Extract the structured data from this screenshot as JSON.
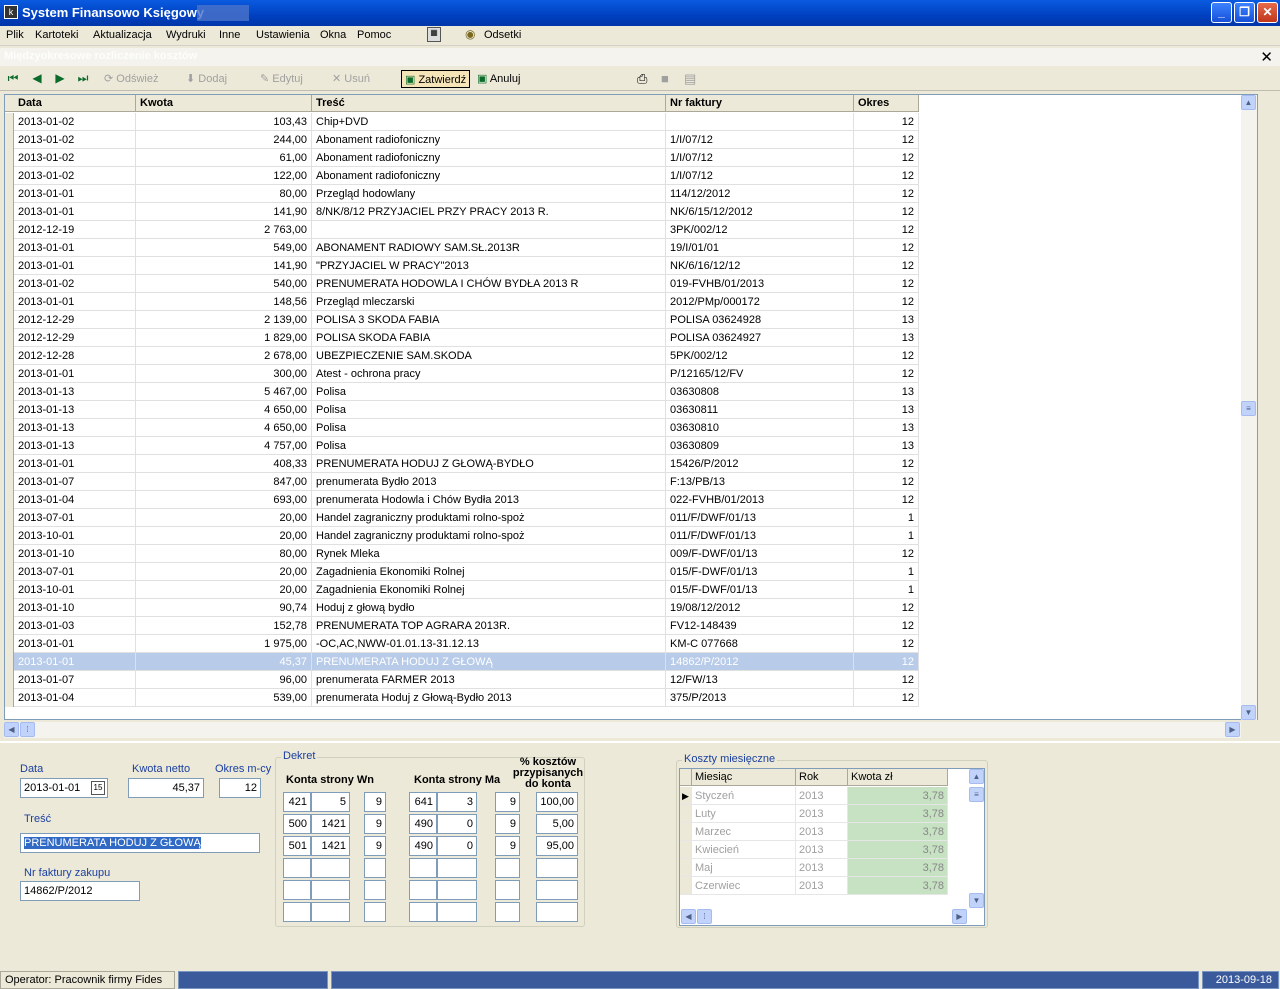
{
  "window": {
    "title": "System Finansowo Księgowy",
    "minimize": "_",
    "maximize": "❐",
    "close": "✕"
  },
  "menu": [
    "Plik",
    "Kartoteki",
    "Aktualizacja",
    "Wydruki",
    "Inne",
    "Ustawienia",
    "Okna",
    "Pomoc"
  ],
  "menu_extra": {
    "odsetki": "Odsetki"
  },
  "subwindow": {
    "title": "Międzyokresowe rozliczenie kosztów",
    "close": "✕"
  },
  "toolbar": {
    "refresh": "Odśwież",
    "add": "Dodaj",
    "edit": "Edytuj",
    "delete": "Usuń",
    "confirm": "Zatwierdź",
    "cancel": "Anuluj"
  },
  "grid": {
    "columns": [
      "Data",
      "Kwota",
      "Treść",
      "Nr faktury",
      "Okres"
    ],
    "rows": [
      [
        "2013-01-02",
        "103,43",
        "Chip+DVD",
        "",
        "12"
      ],
      [
        "2013-01-02",
        "244,00",
        "Abonament radiofoniczny",
        "1/I/07/12",
        "12"
      ],
      [
        "2013-01-02",
        "61,00",
        "Abonament radiofoniczny",
        "1/I/07/12",
        "12"
      ],
      [
        "2013-01-02",
        "122,00",
        "Abonament radiofoniczny",
        "1/I/07/12",
        "12"
      ],
      [
        "2013-01-01",
        "80,00",
        "Przegląd hodowlany",
        "114/12/2012",
        "12"
      ],
      [
        "2013-01-01",
        "141,90",
        "8/NK/8/12 PRZYJACIEL PRZY PRACY 2013 R.",
        "NK/6/15/12/2012",
        "12"
      ],
      [
        "2012-12-19",
        "2 763,00",
        "",
        "3PK/002/12",
        "12"
      ],
      [
        "2013-01-01",
        "549,00",
        "ABONAMENT RADIOWY SAM.SŁ.2013R",
        "19/I/01/01",
        "12"
      ],
      [
        "2013-01-01",
        "141,90",
        "\"PRZYJACIEL W PRACY\"2013",
        "NK/6/16/12/12",
        "12"
      ],
      [
        "2013-01-02",
        "540,00",
        "PRENUMERATA HODOWLA I CHÓW BYDŁA 2013 R",
        "019-FVHB/01/2013",
        "12"
      ],
      [
        "2013-01-01",
        "148,56",
        "Przegląd mleczarski",
        "2012/PMp/000172",
        "12"
      ],
      [
        "2012-12-29",
        "2 139,00",
        "POLISA         3 SKODA FABIA",
        "POLISA 03624928",
        "13"
      ],
      [
        "2012-12-29",
        "1 829,00",
        "POLISA          SKODA FABIA",
        "POLISA 03624927",
        "13"
      ],
      [
        "2012-12-28",
        "2 678,00",
        "UBEZPIECZENIE SAM.SKODA",
        "5PK/002/12",
        "12"
      ],
      [
        "2013-01-01",
        "300,00",
        "Atest - ochrona pracy",
        "P/12165/12/FV",
        "12"
      ],
      [
        "2013-01-13",
        "5 467,00",
        "Polisa",
        "03630808",
        "13"
      ],
      [
        "2013-01-13",
        "4 650,00",
        "Polisa",
        "03630811",
        "13"
      ],
      [
        "2013-01-13",
        "4 650,00",
        "Polisa",
        "03630810",
        "13"
      ],
      [
        "2013-01-13",
        "4 757,00",
        "Polisa",
        "03630809",
        "13"
      ],
      [
        "2013-01-01",
        "408,33",
        "PRENUMERATA HODUJ Z GŁOWĄ-BYDŁO",
        "15426/P/2012",
        "12"
      ],
      [
        "2013-01-07",
        "847,00",
        "prenumerata  Bydło 2013",
        "F:13/PB/13",
        "12"
      ],
      [
        "2013-01-04",
        "693,00",
        "prenumerata Hodowla i Chów Bydła 2013",
        "022-FVHB/01/2013",
        "12"
      ],
      [
        "2013-07-01",
        "20,00",
        "Handel zagraniczny produktami rolno-spoż",
        "011/F/DWF/01/13",
        "1"
      ],
      [
        "2013-10-01",
        "20,00",
        "Handel zagraniczny produktami rolno-spoż",
        "011/F/DWF/01/13",
        "1"
      ],
      [
        "2013-01-10",
        "80,00",
        "Rynek Mleka",
        "009/F-DWF/01/13",
        "12"
      ],
      [
        "2013-07-01",
        "20,00",
        "Zagadnienia Ekonomiki Rolnej",
        "015/F-DWF/01/13",
        "1"
      ],
      [
        "2013-10-01",
        "20,00",
        "Zagadnienia Ekonomiki Rolnej",
        "015/F-DWF/01/13",
        "1"
      ],
      [
        "2013-01-10",
        "90,74",
        "Hoduj z głową bydło",
        "19/08/12/2012",
        "12"
      ],
      [
        "2013-01-03",
        "152,78",
        "PRENUMERATA TOP AGRARA 2013R.",
        "FV12-148439",
        "12"
      ],
      [
        "2013-01-01",
        "1 975,00",
        "           -OC,AC,NWW-01.01.13-31.12.13",
        "KM-C 077668",
        "12"
      ],
      [
        "2013-01-01",
        "45,37",
        "PRENUMERATA HODUJ Z GŁOWĄ",
        "14862/P/2012",
        "12"
      ],
      [
        "2013-01-07",
        "96,00",
        "prenumerata FARMER 2013",
        "12/FW/13",
        "12"
      ],
      [
        "2013-01-04",
        "539,00",
        "prenumerata Hoduj z Głową-Bydło 2013",
        "375/P/2013",
        "12"
      ]
    ],
    "selected_index": 30
  },
  "form": {
    "data_label": "Data",
    "data_value": "2013-01-01",
    "cal_icon": "15",
    "kwota_label": "Kwota netto",
    "kwota_value": "45,37",
    "okres_label": "Okres m-cy",
    "okres_value": "12",
    "tresc_label": "Treść",
    "tresc_value": "PRENUMERATA HODUJ Z GŁOWĄ",
    "faktura_label": "Nr faktury zakupu",
    "faktura_value": "14862/P/2012"
  },
  "dekret": {
    "title": "Dekret",
    "wn_header": "Konta strony Wn",
    "ma_header": "Konta strony Ma",
    "pct_header": "% kosztów przypisanych do konta",
    "rows": [
      [
        "421",
        "5",
        "9",
        "641",
        "3",
        "9",
        "100,00"
      ],
      [
        "500",
        "1421",
        "9",
        "490",
        "0",
        "9",
        "5,00"
      ],
      [
        "501",
        "1421",
        "9",
        "490",
        "0",
        "9",
        "95,00"
      ],
      [
        "",
        "",
        "",
        "",
        "",
        "",
        ""
      ],
      [
        "",
        "",
        "",
        "",
        "",
        "",
        ""
      ],
      [
        "",
        "",
        "",
        "",
        "",
        "",
        ""
      ]
    ]
  },
  "koszty": {
    "title": "Koszty miesięczne",
    "columns": [
      "Miesiąc",
      "Rok",
      "Kwota zł"
    ],
    "rows": [
      [
        "Styczeń",
        "2013",
        "3,78"
      ],
      [
        "Luty",
        "2013",
        "3,78"
      ],
      [
        "Marzec",
        "2013",
        "3,78"
      ],
      [
        "Kwiecień",
        "2013",
        "3,78"
      ],
      [
        "Maj",
        "2013",
        "3,78"
      ],
      [
        "Czerwiec",
        "2013",
        "3,78"
      ]
    ]
  },
  "status": {
    "operator": "Operator: Pracownik firmy Fides",
    "date": "2013-09-18"
  }
}
